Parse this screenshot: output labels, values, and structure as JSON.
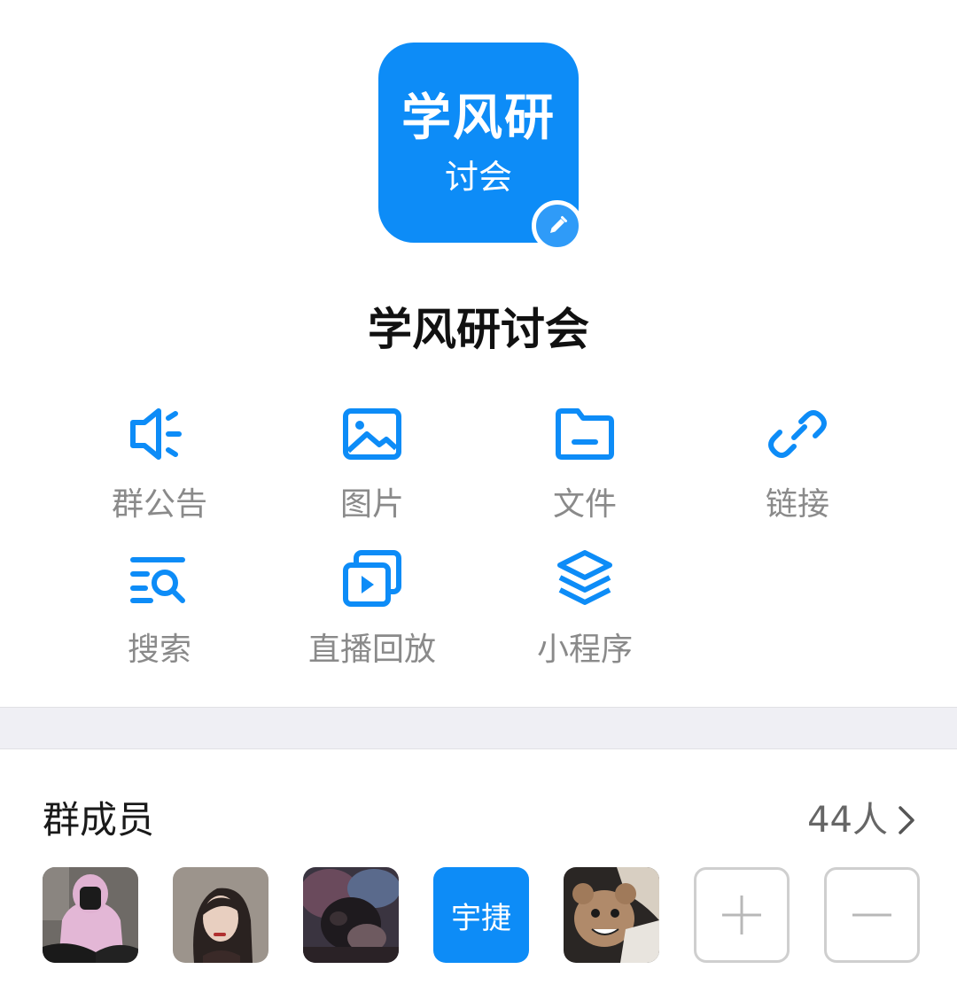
{
  "group": {
    "avatar_line1": "学风研",
    "avatar_line2": "讨会",
    "name": "学风研讨会"
  },
  "functions": [
    {
      "label": "群公告",
      "icon": "announcement-icon"
    },
    {
      "label": "图片",
      "icon": "image-icon"
    },
    {
      "label": "文件",
      "icon": "folder-icon"
    },
    {
      "label": "链接",
      "icon": "link-icon"
    },
    {
      "label": "搜索",
      "icon": "search-list-icon"
    },
    {
      "label": "直播回放",
      "icon": "video-playback-icon"
    },
    {
      "label": "小程序",
      "icon": "layers-icon"
    }
  ],
  "members": {
    "title": "群成员",
    "count": "44人",
    "avatars": [
      {
        "type": "photo",
        "icon": "member-avatar-1"
      },
      {
        "type": "photo",
        "icon": "member-avatar-2"
      },
      {
        "type": "photo",
        "icon": "member-avatar-3"
      },
      {
        "type": "text",
        "text": "宇捷"
      },
      {
        "type": "photo",
        "icon": "member-avatar-5"
      }
    ]
  },
  "colors": {
    "accent": "#0d8cf7",
    "label_gray": "#8a8a8a",
    "divider": "#efeff4"
  }
}
